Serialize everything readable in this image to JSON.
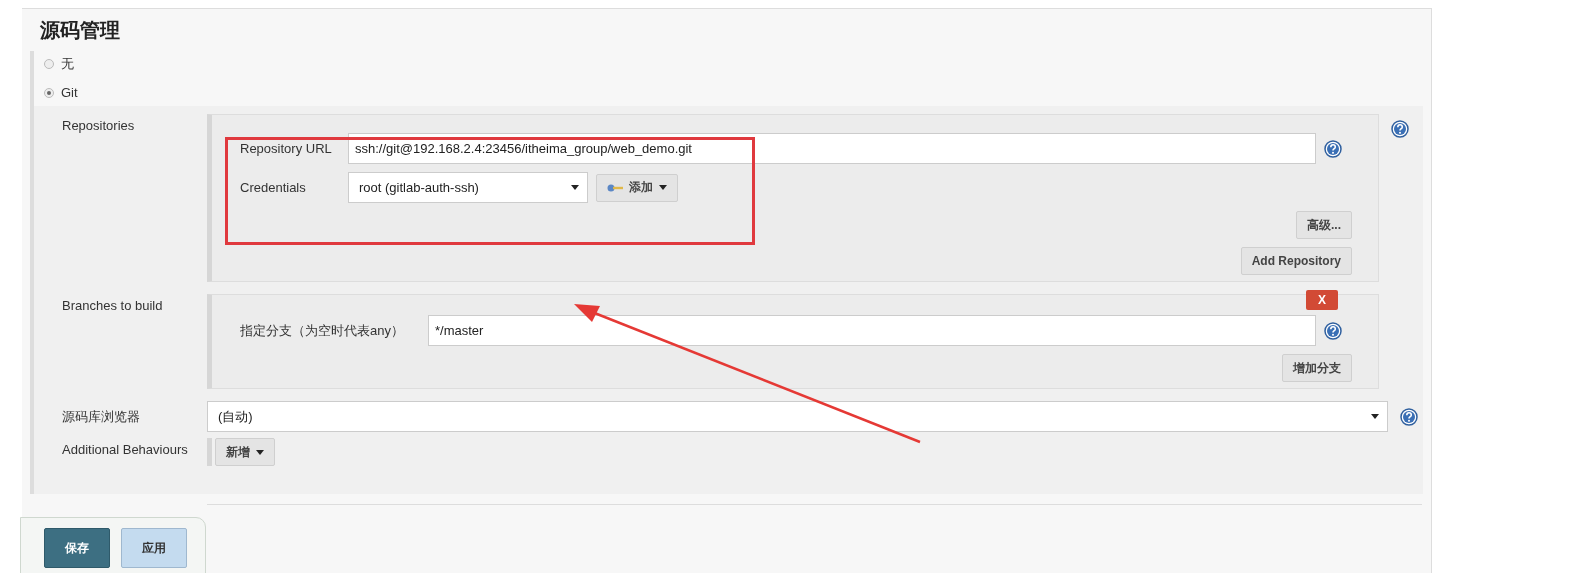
{
  "section_title": "源码管理",
  "scm_options": [
    {
      "label": "无",
      "selected": false
    },
    {
      "label": "Git",
      "selected": true
    }
  ],
  "repositories": {
    "label": "Repositories",
    "url_label": "Repository URL",
    "url": "ssh://git@192.168.2.4:23456/itheima_group/web_demo.git",
    "credentials_label": "Credentials",
    "credentials": "root (gitlab-auth-ssh)",
    "add_button": "添加",
    "advanced_button": "高级...",
    "add_repository_button": "Add Repository"
  },
  "branches": {
    "label": "Branches to build",
    "delete_button": "X",
    "branch_label": "指定分支（为空时代表any）",
    "branch": "*/master",
    "add_branch_button": "增加分支"
  },
  "browser": {
    "label": "源码库浏览器",
    "value": "(自动)"
  },
  "behaviours": {
    "label": "Additional Behaviours",
    "add_button": "新增"
  },
  "footer_buttons": [
    {
      "label": "保存",
      "kind": "primary"
    },
    {
      "label": "应用",
      "kind": "secondary"
    }
  ]
}
